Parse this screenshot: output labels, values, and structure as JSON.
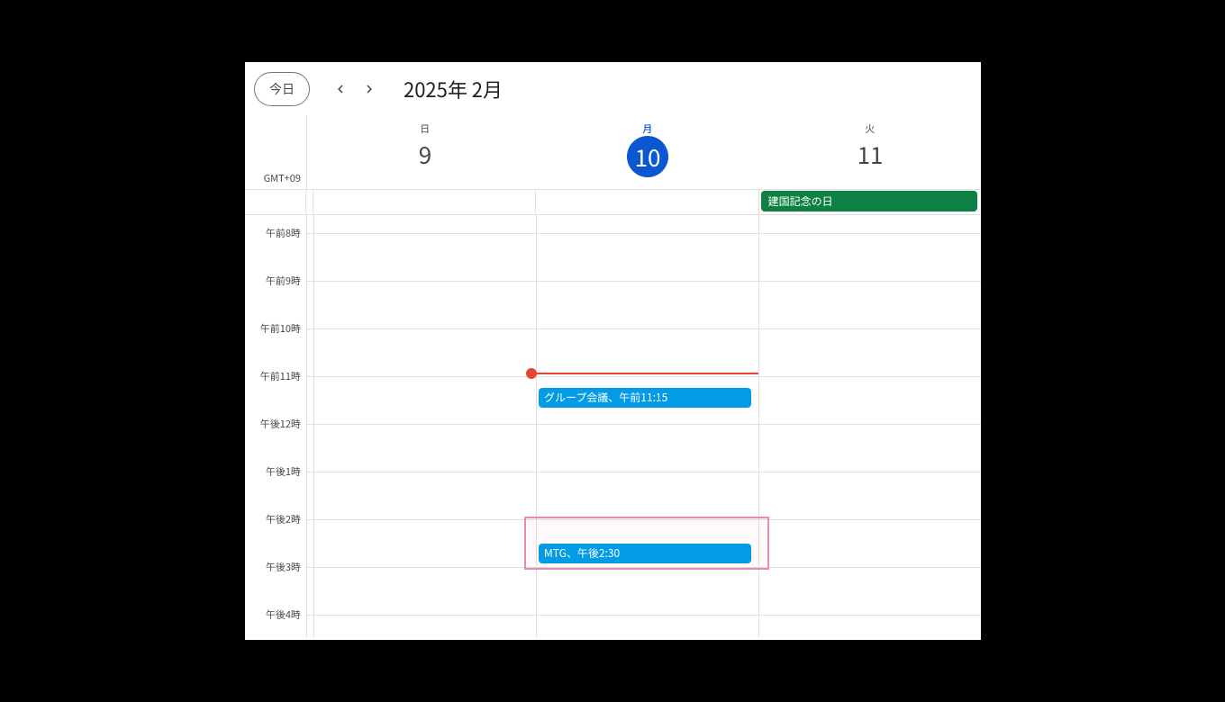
{
  "header": {
    "today_label": "今日",
    "date_title": "2025年 2月"
  },
  "timezone": "GMT+09",
  "days": [
    {
      "dow": "日",
      "num": "9",
      "is_today": false
    },
    {
      "dow": "月",
      "num": "10",
      "is_today": true
    },
    {
      "dow": "火",
      "num": "11",
      "is_today": false
    }
  ],
  "hour_labels": [
    "午前8時",
    "午前9時",
    "午前10時",
    "午前11時",
    "午後12時",
    "午後1時",
    "午後2時",
    "午後3時",
    "午後4時"
  ],
  "hour_height": 53,
  "now_offset_min_from_8": 175,
  "allday_events": {
    "col2": {
      "title": "建国記念の日"
    }
  },
  "events": {
    "group_meeting": {
      "title": "グループ会議、午前11:15",
      "col": 1,
      "start_min_from_8": 195,
      "dur_min": 25
    },
    "mtg": {
      "title": "MTG、午後2:30",
      "col": 1,
      "start_min_from_8": 390,
      "dur_min": 25
    }
  }
}
